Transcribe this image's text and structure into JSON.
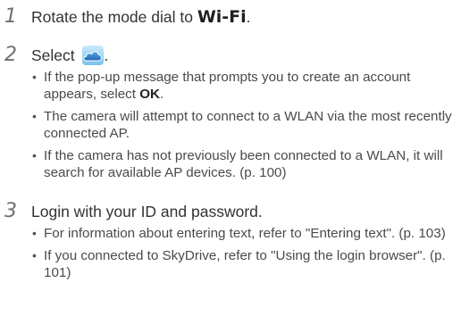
{
  "steps": [
    {
      "number": "1",
      "text": "Rotate the mode dial to ",
      "emphasis": "Wi-Fi",
      "suffix": ".",
      "bullets": []
    },
    {
      "number": "2",
      "text": "Select ",
      "icon": "skydrive-cloud-icon",
      "suffix": ".",
      "bullets": [
        {
          "before": "If the pop-up message that prompts you to create an account appears, select ",
          "bold": "OK",
          "after": "."
        },
        {
          "text": "The camera will attempt to connect to a WLAN via the most recently connected AP."
        },
        {
          "text": "If the camera has not previously been connected to a WLAN, it will search for available AP devices. (p. 100)"
        }
      ]
    },
    {
      "number": "3",
      "text": "Login with your ID and password.",
      "bullets": [
        {
          "text": "For information about entering text, refer to \"Entering text\". (p. 103)"
        },
        {
          "text": "If you connected to SkyDrive, refer to \"Using the login browser\". (p. 101)"
        }
      ]
    }
  ],
  "colors": {
    "step_number": "#6f6f6f",
    "body_text": "#4a4a4a",
    "cloud_blue": "#2a7fd0",
    "cloud_sky": "#8fd0f2"
  }
}
